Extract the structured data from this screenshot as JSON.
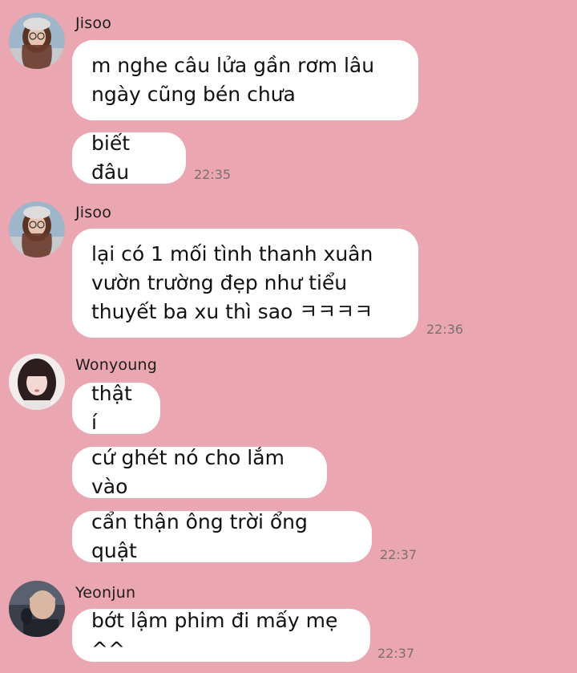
{
  "colors": {
    "background": "#eba7b1",
    "bubble": "#ffffff",
    "timestamp": "#7b6f72"
  },
  "messages": [
    {
      "sender": "Jisoo",
      "avatar": "jisoo-avatar",
      "bubbles": [
        "m nghe câu lửa gần rơm lâu\nngày cũng bén chưa",
        "biết đâu"
      ],
      "time": "22:35"
    },
    {
      "sender": "Jisoo",
      "avatar": "jisoo-avatar",
      "bubbles": [
        "lại có 1 mối tình thanh xuân\nvườn trường đẹp như tiểu\nthuyết ba xu thì sao ㅋㅋㅋㅋ"
      ],
      "time": "22:36"
    },
    {
      "sender": "Wonyoung",
      "avatar": "wonyoung-avatar",
      "bubbles": [
        "thật í",
        "cứ ghét nó cho lắm vào",
        "cẩn thận ông trời ổng quật"
      ],
      "time": "22:37"
    },
    {
      "sender": "Yeonjun",
      "avatar": "yeonjun-avatar",
      "bubbles": [
        "bớt lậm phim đi mấy mẹ ^^"
      ],
      "time": "22:37"
    }
  ]
}
